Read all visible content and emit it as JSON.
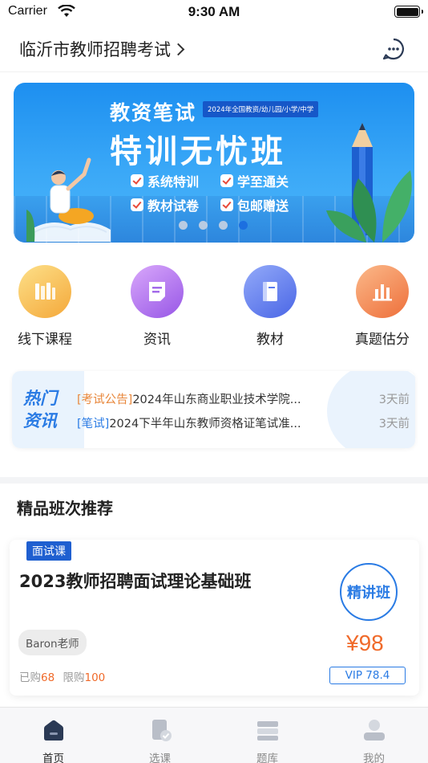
{
  "status_bar": {
    "carrier": "Carrier",
    "time": "9:30 AM"
  },
  "header": {
    "city": "临沂市教师招聘考试"
  },
  "banner": {
    "title_line1": "教资笔试",
    "tag": "2024年全国教资/幼儿园/小学/中学",
    "title_line2": "特训无忧班",
    "features": [
      "系统特训",
      "学至通关",
      "教材试卷",
      "包邮赠送"
    ],
    "active_dot": 4,
    "dot_count": 4
  },
  "quick_nav": [
    {
      "label": "线下课程",
      "icon": "book-stack-icon",
      "color": "#f5b94a"
    },
    {
      "label": "资讯",
      "icon": "document-icon",
      "color": "#a36bea"
    },
    {
      "label": "教材",
      "icon": "textbook-icon",
      "color": "#5a7cf0"
    },
    {
      "label": "真题估分",
      "icon": "bar-chart-icon",
      "color": "#f28a4f"
    }
  ],
  "news": {
    "badge": "热门资讯",
    "items": [
      {
        "tag": "[考试公告]",
        "text": "2024年山东商业职业技术学院...",
        "time": "3天前",
        "tag_color": "orange"
      },
      {
        "tag": "[笔试]",
        "text": "2024下半年山东教师资格证笔试准...",
        "time": "3天前",
        "tag_color": "blue"
      }
    ]
  },
  "section": {
    "title": "精品班次推荐"
  },
  "course": {
    "type": "面试课",
    "title": "2023教师招聘面试理论基础班",
    "stamp": "精讲班",
    "teacher": "Baron老师",
    "price": "¥98",
    "bought_label": "已购",
    "bought": "68",
    "limit_label": "限购",
    "limit": "100",
    "vip": "VIP 78.4"
  },
  "tab_bar": {
    "tabs": [
      {
        "label": "首页",
        "icon": "home-icon",
        "active": true
      },
      {
        "label": "选课",
        "icon": "course-select-icon",
        "active": false
      },
      {
        "label": "题库",
        "icon": "question-bank-icon",
        "active": false
      },
      {
        "label": "我的",
        "icon": "profile-icon",
        "active": false
      }
    ]
  },
  "colors": {
    "accent_blue": "#2a7be4",
    "price_orange": "#f06a2a",
    "tag_blue": "#1f5fd0"
  }
}
